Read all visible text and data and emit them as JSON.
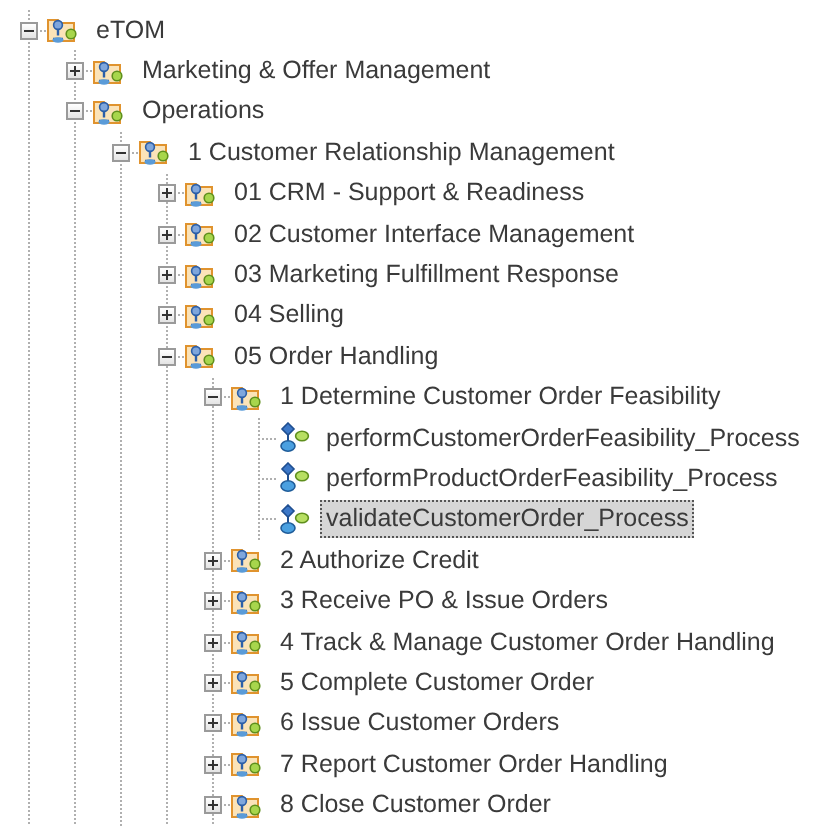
{
  "tree": {
    "items": [
      {
        "label": "eTOM",
        "kind": "folder",
        "expanded": true,
        "selected": false,
        "children": [
          {
            "label": "Marketing & Offer Management",
            "kind": "folder",
            "expanded": false,
            "selected": false
          },
          {
            "label": "Operations",
            "kind": "folder",
            "expanded": true,
            "selected": false,
            "children": [
              {
                "label": "1 Customer Relationship Management",
                "kind": "folder",
                "expanded": true,
                "selected": false,
                "children": [
                  {
                    "label": "01 CRM - Support & Readiness",
                    "kind": "folder",
                    "expanded": false,
                    "selected": false
                  },
                  {
                    "label": "02 Customer Interface Management",
                    "kind": "folder",
                    "expanded": false,
                    "selected": false
                  },
                  {
                    "label": "03 Marketing Fulfillment Response",
                    "kind": "folder",
                    "expanded": false,
                    "selected": false
                  },
                  {
                    "label": "04 Selling",
                    "kind": "folder",
                    "expanded": false,
                    "selected": false
                  },
                  {
                    "label": "05 Order Handling",
                    "kind": "folder",
                    "expanded": true,
                    "selected": false,
                    "children": [
                      {
                        "label": "1 Determine Customer Order Feasibility",
                        "kind": "folder",
                        "expanded": true,
                        "selected": false,
                        "children": [
                          {
                            "label": "performCustomerOrderFeasibility_Process",
                            "kind": "process",
                            "selected": false
                          },
                          {
                            "label": "performProductOrderFeasibility_Process",
                            "kind": "process",
                            "selected": false
                          },
                          {
                            "label": "validateCustomerOrder_Process",
                            "kind": "process",
                            "selected": true
                          }
                        ]
                      },
                      {
                        "label": "2 Authorize Credit",
                        "kind": "folder",
                        "expanded": false,
                        "selected": false
                      },
                      {
                        "label": "3 Receive PO & Issue Orders",
                        "kind": "folder",
                        "expanded": false,
                        "selected": false
                      },
                      {
                        "label": "4 Track & Manage Customer Order Handling",
                        "kind": "folder",
                        "expanded": false,
                        "selected": false
                      },
                      {
                        "label": "5 Complete Customer Order",
                        "kind": "folder",
                        "expanded": false,
                        "selected": false
                      },
                      {
                        "label": "6 Issue Customer Orders",
                        "kind": "folder",
                        "expanded": false,
                        "selected": false
                      },
                      {
                        "label": "7 Report Customer Order Handling",
                        "kind": "folder",
                        "expanded": false,
                        "selected": false
                      },
                      {
                        "label": "8 Close Customer Order",
                        "kind": "folder",
                        "expanded": false,
                        "selected": false
                      }
                    ]
                  }
                ]
              }
            ]
          }
        ]
      }
    ]
  }
}
